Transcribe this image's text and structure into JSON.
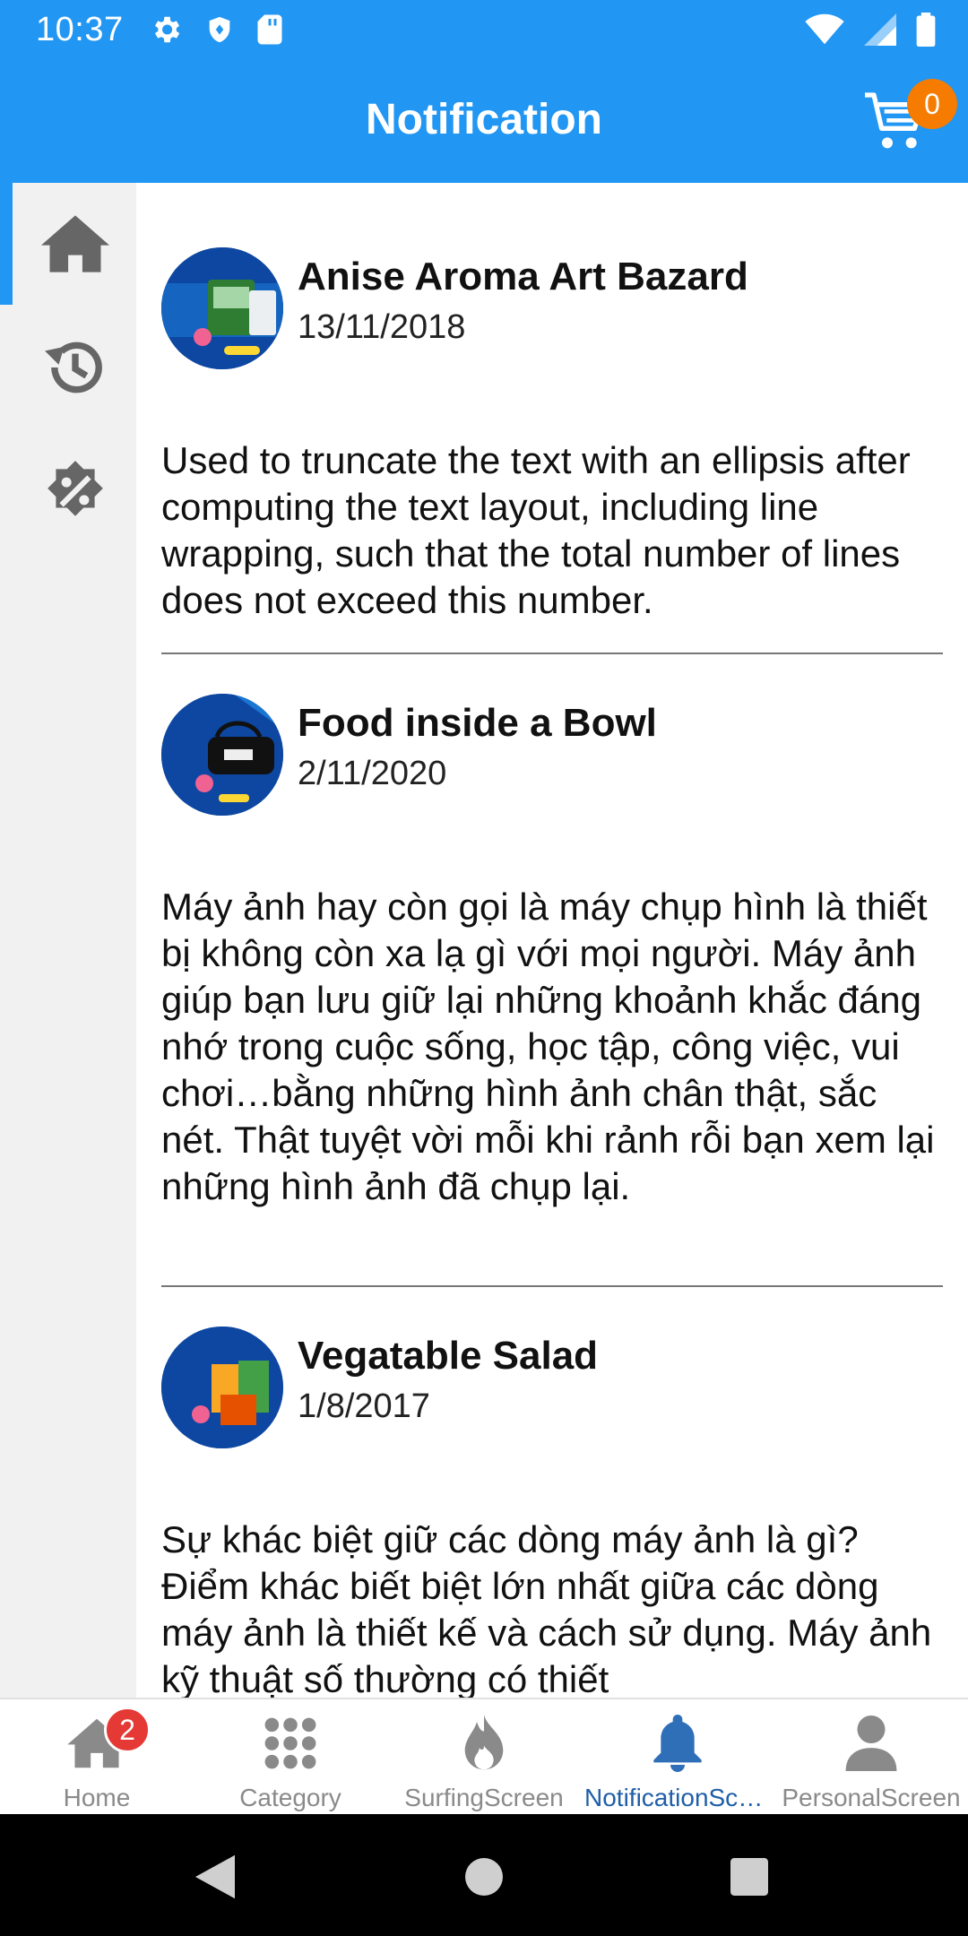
{
  "status_bar": {
    "time": "10:37",
    "icons_left": [
      "gear-icon",
      "shield-icon",
      "sd-card-icon"
    ],
    "icons_right": [
      "wifi-icon",
      "cell-signal-icon",
      "battery-icon"
    ]
  },
  "header": {
    "title": "Notification",
    "cart_count": "0"
  },
  "left_rail": {
    "items": [
      "home-icon",
      "history-icon",
      "discount-icon"
    ],
    "active_index": 0
  },
  "notifications": [
    {
      "title": "Anise Aroma Art Bazard",
      "date": "13/11/2018",
      "body": "Used to truncate the text with an ellipsis after computing the text layout, including line wrapping, such that the total number of lines does not exceed this number."
    },
    {
      "title": "Food inside a Bowl",
      "date": "2/11/2020",
      "body": "Máy ảnh hay còn gọi là máy chụp hình là thiết bị không còn xa lạ gì với mọi người. Máy ảnh giúp bạn lưu giữ lại những khoảnh khắc đáng nhớ trong cuộc sống, học tập, công việc, vui chơi…bằng những hình ảnh chân thật, sắc nét. Thật tuyệt vời mỗi khi rảnh rỗi bạn xem lại những hình ảnh đã chụp lại."
    },
    {
      "title": "Vegatable Salad",
      "date": "1/8/2017",
      "body": "Sự khác biệt giữ các dòng máy ảnh là gì? Điểm khác biết biệt lớn nhất giữa các dòng máy ảnh là thiết kế và cách sử dụng. Máy ảnh kỹ thuật số thường có thiết"
    }
  ],
  "bottom_nav": {
    "items": [
      {
        "label": "Home",
        "icon": "home-icon",
        "badge": "2"
      },
      {
        "label": "Category",
        "icon": "grid-dots-icon"
      },
      {
        "label": "SurfingScreen",
        "icon": "fire-icon"
      },
      {
        "label": "NotificationScr…",
        "icon": "bell-icon"
      },
      {
        "label": "PersonalScreen",
        "icon": "person-icon"
      }
    ],
    "active_index": 3
  },
  "colors": {
    "primary": "#2196F3",
    "badge_orange": "#F57C00",
    "badge_red": "#E53935",
    "nav_active": "#1F5FA8",
    "nav_inactive": "#8A8A8A"
  }
}
